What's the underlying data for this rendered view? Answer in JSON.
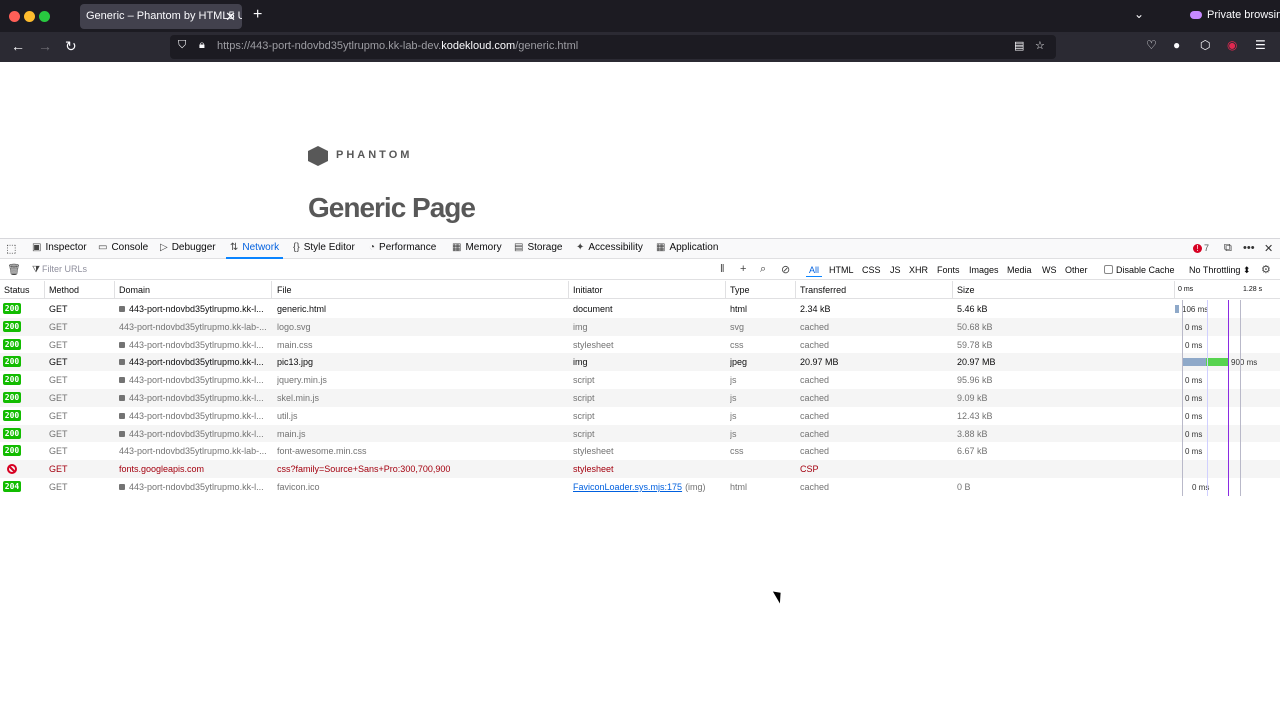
{
  "browser": {
    "tab_title": "Generic – Phantom by HTML5 UP",
    "tab_close": "✕",
    "new_tab": "+",
    "private_label": "Private browsing",
    "url_prefix": "https://443-port-ndovbd35ytlrupmo.kk-lab-dev.",
    "url_domain": "kodekloud.com",
    "url_path": "/generic.html"
  },
  "page": {
    "logo_text": "PHANTOM",
    "heading": "Generic Page"
  },
  "devtools": {
    "tabs": [
      {
        "label": "Inspector",
        "icon": "inspector-icon",
        "glyph": "▣"
      },
      {
        "label": "Console",
        "icon": "console-icon",
        "glyph": "▭"
      },
      {
        "label": "Debugger",
        "icon": "debugger-icon",
        "glyph": "▷"
      },
      {
        "label": "Network",
        "icon": "network-icon",
        "glyph": "⇅",
        "active": true
      },
      {
        "label": "Style Editor",
        "icon": "style-editor-icon",
        "glyph": "{}"
      },
      {
        "label": "Performance",
        "icon": "performance-icon",
        "glyph": "◔"
      },
      {
        "label": "Memory",
        "icon": "memory-icon",
        "glyph": "▦"
      },
      {
        "label": "Storage",
        "icon": "storage-icon",
        "glyph": "▤"
      },
      {
        "label": "Accessibility",
        "icon": "accessibility-icon",
        "glyph": "✦"
      },
      {
        "label": "Application",
        "icon": "application-icon",
        "glyph": "▦"
      }
    ],
    "error_count": "7",
    "filter_placeholder": "Filter URLs",
    "filter_types": [
      "All",
      "HTML",
      "CSS",
      "JS",
      "XHR",
      "Fonts",
      "Images",
      "Media",
      "WS",
      "Other"
    ],
    "disable_cache_label": "Disable Cache",
    "throttling_label": "No Throttling ⬍",
    "columns": [
      "Status",
      "Method",
      "Domain",
      "File",
      "Initiator",
      "Type",
      "Transferred",
      "Size"
    ],
    "waterfall_ticks": [
      "0 ms",
      "1.28 s"
    ],
    "rows": [
      {
        "status": "200",
        "method": "GET",
        "domain": "443-port-ndovbd35ytlrupmo.kk-l...",
        "file": "generic.html",
        "initiator": "document",
        "type": "html",
        "transferred": "2.34 kB",
        "size": "5.46 kB",
        "timing": "106 ms",
        "cached": false,
        "secure": true
      },
      {
        "status": "200",
        "method": "GET",
        "domain": "443-port-ndovbd35ytlrupmo.kk-lab-...",
        "file": "logo.svg",
        "initiator": "img",
        "type": "svg",
        "transferred": "cached",
        "size": "50.68 kB",
        "timing": "0 ms",
        "cached": true,
        "secure": false
      },
      {
        "status": "200",
        "method": "GET",
        "domain": "443-port-ndovbd35ytlrupmo.kk-l...",
        "file": "main.css",
        "initiator": "stylesheet",
        "type": "css",
        "transferred": "cached",
        "size": "59.78 kB",
        "timing": "0 ms",
        "cached": true,
        "secure": true
      },
      {
        "status": "200",
        "method": "GET",
        "domain": "443-port-ndovbd35ytlrupmo.kk-l...",
        "file": "pic13.jpg",
        "initiator": "img",
        "type": "jpeg",
        "transferred": "20.97 MB",
        "size": "20.97 MB",
        "timing": "900 ms",
        "cached": false,
        "secure": true
      },
      {
        "status": "200",
        "method": "GET",
        "domain": "443-port-ndovbd35ytlrupmo.kk-l...",
        "file": "jquery.min.js",
        "initiator": "script",
        "type": "js",
        "transferred": "cached",
        "size": "95.96 kB",
        "timing": "0 ms",
        "cached": true,
        "secure": true
      },
      {
        "status": "200",
        "method": "GET",
        "domain": "443-port-ndovbd35ytlrupmo.kk-l...",
        "file": "skel.min.js",
        "initiator": "script",
        "type": "js",
        "transferred": "cached",
        "size": "9.09 kB",
        "timing": "0 ms",
        "cached": true,
        "secure": true
      },
      {
        "status": "200",
        "method": "GET",
        "domain": "443-port-ndovbd35ytlrupmo.kk-l...",
        "file": "util.js",
        "initiator": "script",
        "type": "js",
        "transferred": "cached",
        "size": "12.43 kB",
        "timing": "0 ms",
        "cached": true,
        "secure": true
      },
      {
        "status": "200",
        "method": "GET",
        "domain": "443-port-ndovbd35ytlrupmo.kk-l...",
        "file": "main.js",
        "initiator": "script",
        "type": "js",
        "transferred": "cached",
        "size": "3.88 kB",
        "timing": "0 ms",
        "cached": true,
        "secure": true
      },
      {
        "status": "200",
        "method": "GET",
        "domain": "443-port-ndovbd35ytlrupmo.kk-lab-...",
        "file": "font-awesome.min.css",
        "initiator": "stylesheet",
        "type": "css",
        "transferred": "cached",
        "size": "6.67 kB",
        "timing": "0 ms",
        "cached": true,
        "secure": false
      },
      {
        "status": "",
        "method": "GET",
        "domain": "fonts.googleapis.com",
        "file": "css?family=Source+Sans+Pro:300,700,900",
        "initiator": "stylesheet",
        "type": "",
        "transferred": "CSP",
        "size": "",
        "timing": "",
        "cached": false,
        "blocked": true,
        "secure": false
      },
      {
        "status": "204",
        "method": "GET",
        "domain": "443-port-ndovbd35ytlrupmo.kk-l...",
        "file": "favicon.ico",
        "initiator": "FaviconLoader.sys.mjs:175",
        "initiator_suffix": "(img)",
        "type": "html",
        "transferred": "cached",
        "size": "0 B",
        "timing": "0 ms",
        "cached": true,
        "secure": true
      }
    ]
  }
}
